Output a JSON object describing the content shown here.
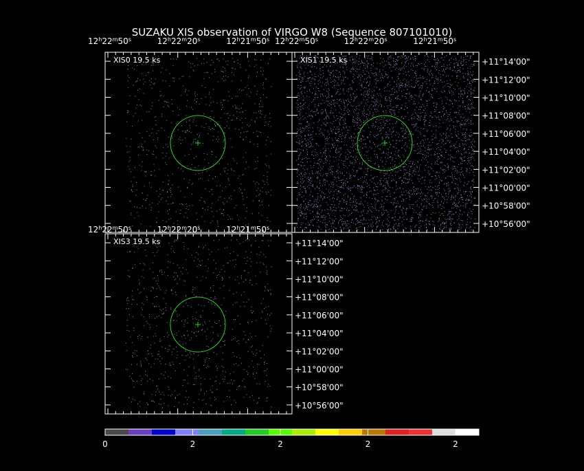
{
  "title": "SUZAKU XIS observation of VIRGO W8  (Sequence 807101010)",
  "panels": [
    {
      "id": "xis0",
      "label": "XIS0  19.5 ks",
      "density": 0.09,
      "color": "#8f8fc8"
    },
    {
      "id": "xis1",
      "label": "XIS1  19.5 ks",
      "density": 0.45,
      "color": "#8a8ad0"
    },
    {
      "id": "xis3",
      "label": "XIS3  19.5 ks",
      "density": 0.09,
      "color": "#8f8fc8"
    }
  ],
  "ra_tick_labels": [
    "12h22m50s",
    "12h22m20s",
    "12h21m50s"
  ],
  "ra_tick_display": [
    {
      "h": "12",
      "m": "22",
      "s": "50"
    },
    {
      "h": "12",
      "m": "22",
      "s": "20"
    },
    {
      "h": "12",
      "m": "21",
      "s": "50"
    }
  ],
  "dec_tick_labels": [
    "+11°14'00\"",
    "+11°12'00\"",
    "+11°10'00\"",
    "+11°08'00\"",
    "+11°06'00\"",
    "+11°04'00\"",
    "+11°02'00\"",
    "+11°00'00\"",
    "+10°58'00\"",
    "+10°56'00\""
  ],
  "source_region": {
    "shape": "circle",
    "color": "#22dd22",
    "marker": "cross"
  },
  "colorbar": {
    "colors": [
      "#4a4a4a",
      "#6a3fbf",
      "#0000cc",
      "#7f7fff",
      "#4a9fbf",
      "#00aa88",
      "#22cc22",
      "#55ff00",
      "#aaee00",
      "#ffff00",
      "#ffcc00",
      "#bb7700",
      "#dd2222",
      "#ee3333",
      "#dddddd",
      "#ffffff"
    ],
    "tick_labels": [
      "0",
      "2",
      "2",
      "2",
      "2"
    ]
  },
  "chart_data": {
    "type": "heatmap",
    "title": "SUZAKU XIS observation of VIRGO W8  (Sequence 807101010)",
    "xlabel": "",
    "ylabel": "",
    "x_ticks": [
      "12h22m50s",
      "12h22m20s",
      "12h21m50s"
    ],
    "y_ticks": [
      "+11°14'00\"",
      "+11°12'00\"",
      "+11°10'00\"",
      "+11°08'00\"",
      "+11°06'00\"",
      "+11°04'00\"",
      "+11°02'00\"",
      "+11°00'00\"",
      "+10°58'00\"",
      "+10°56'00\""
    ],
    "series": [
      {
        "name": "XIS0  19.5 ks",
        "exposure_ks": 19.5
      },
      {
        "name": "XIS1  19.5 ks",
        "exposure_ks": 19.5
      },
      {
        "name": "XIS3  19.5 ks",
        "exposure_ks": 19.5
      }
    ],
    "colorbar_ticks": [
      "0",
      "2",
      "2",
      "2",
      "2"
    ]
  }
}
